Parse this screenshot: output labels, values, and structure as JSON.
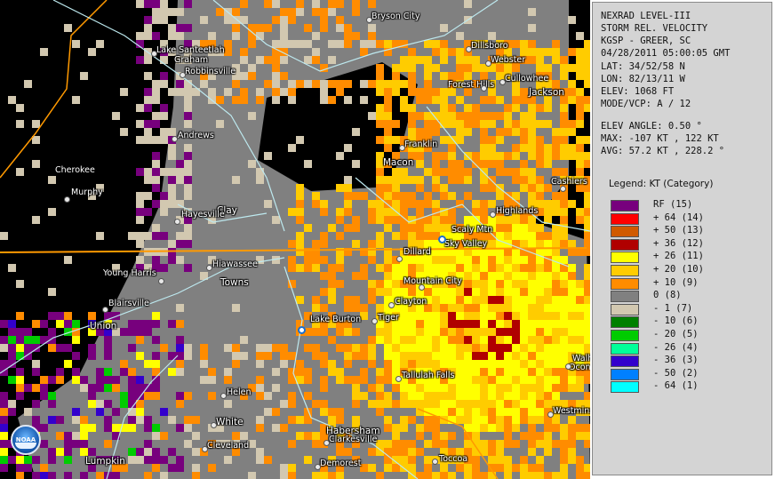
{
  "info": {
    "lines": [
      "NEXRAD LEVEL-III",
      "STORM REL. VELOCITY",
      "KGSP - GREER, SC",
      "04/28/2011 05:00:05 GMT",
      "LAT: 34/52/58 N",
      "LON: 82/13/11 W",
      "ELEV: 1068 FT",
      "MODE/VCP: A / 12"
    ],
    "lines2": [
      "ELEV ANGLE: 0.50 °",
      "MAX: -107 KT , 122 KT",
      "AVG: 57.2 KT , 228.2 °"
    ]
  },
  "legend": {
    "title": "Legend: KT (Category)",
    "items": [
      {
        "label": "RF  (15)",
        "color": "#77007d"
      },
      {
        "label": "+ 64  (14)",
        "color": "#ff0000"
      },
      {
        "label": "+ 50  (13)",
        "color": "#d05a00"
      },
      {
        "label": "+ 36  (12)",
        "color": "#b00000"
      },
      {
        "label": "+ 26  (11)",
        "color": "#ffff00"
      },
      {
        "label": "+ 20  (10)",
        "color": "#ffcc00"
      },
      {
        "label": "+ 10  (9)",
        "color": "#ff8c00"
      },
      {
        "label": "0  (8)",
        "color": "#808080"
      },
      {
        "label": "- 1  (7)",
        "color": "#d2c8b0"
      },
      {
        "label": "- 10  (6)",
        "color": "#008000"
      },
      {
        "label": "- 20  (5)",
        "color": "#00cc00"
      },
      {
        "label": "- 26  (4)",
        "color": "#00ff99"
      },
      {
        "label": "- 36  (3)",
        "color": "#3300cc"
      },
      {
        "label": "- 50  (2)",
        "color": "#0080ff"
      },
      {
        "label": "- 64  (1)",
        "color": "#00ffff"
      }
    ]
  },
  "map": {
    "places": [
      "Bryson City",
      "Dillsboro",
      "Lake Santeetlah",
      "Graham",
      "Robbinsville",
      "Webster",
      "Forest Hills",
      "Cullowhee",
      "Jackson",
      "Andrews",
      "Franklin",
      "Macon",
      "Cherokee",
      "Murphy",
      "Cashiers",
      "Clay",
      "Hayesville",
      "Highlands",
      "Scaly Mtn",
      "Sky Valley",
      "Dillard",
      "Hiawassee",
      "Young Harris",
      "Towns",
      "Mountain City",
      "Clayton",
      "Blairsville",
      "Lake Burton",
      "Tiger",
      "Union",
      "Tallulah Falls",
      "Walhalla",
      "Oconee",
      "Helen",
      "Westminster",
      "White",
      "Habersham",
      "Clarkesville",
      "Cleveland",
      "Demorest",
      "Toccoa",
      "Lumpkin"
    ],
    "logo": "NOAA"
  }
}
